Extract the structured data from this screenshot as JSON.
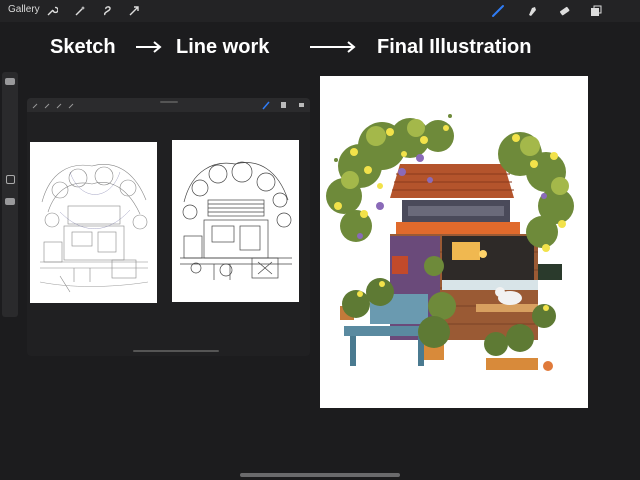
{
  "topbar": {
    "gallery_label": "Gallery",
    "left_tools": [
      "wrench-icon",
      "magic-wand-icon",
      "selection-icon",
      "transform-icon"
    ],
    "right_tools": [
      "brush-icon",
      "smudge-icon",
      "eraser-icon",
      "layers-icon"
    ],
    "accent": "#2f7cf6"
  },
  "headlines": {
    "sketch": "Sketch",
    "linework": "Line work",
    "final": "Final Illustration"
  }
}
